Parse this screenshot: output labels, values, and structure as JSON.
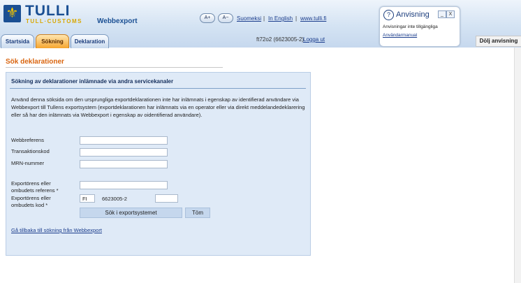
{
  "header": {
    "logo_main": "TULLI",
    "logo_sub": "TULL·CUSTOMS",
    "app_name": "Webbexport",
    "font_increase": "A+",
    "font_decrease": "A−",
    "lang_finnish": "Suomeksi",
    "lang_english": "In English",
    "site_link": "www.tulli.fi",
    "separator": "|",
    "user_info": "ft72o2 (6623005-2)",
    "logout": "Logga ut"
  },
  "tabs": [
    {
      "label": "Startsida",
      "active": false
    },
    {
      "label": "Sökning",
      "active": true
    },
    {
      "label": "Deklaration",
      "active": false
    }
  ],
  "help": {
    "icon": "?",
    "title": "Anvisning",
    "minimize": "_",
    "close": "X",
    "text": "Anvisningar inte tillgängliga",
    "manual_link": "Användarmanual",
    "hide_button": "Dölj anvisning"
  },
  "page": {
    "title": "Sök deklarationer",
    "panel_title": "Sökning av deklarationer inlämnade via andra servicekanaler",
    "description": "Använd denna söksida om den ursprungliga exportdeklarationen inte har inlämnats i egenskap av identifierad användare via Webbexport till Tullens exportsystem (exportdeklarationen har inlämnats via en operator eller via direkt meddelandedeklarering eller så har den inlämnats via Webbexport i egenskap av oidentifierad användare).",
    "fields": {
      "webbreferens_label": "Webbreferens",
      "transaktionskod_label": "Transaktionskod",
      "mrn_label": "MRN-nummer",
      "ref_label_line1": "Exportörens eller",
      "ref_label_line2": "ombudets referens  *",
      "code_label_line1": "Exportörens eller",
      "code_label_line2": "ombudets kod  *",
      "country_code": "FI",
      "company_code": "6623005-2",
      "webbreferens_value": "",
      "transaktionskod_value": "",
      "mrn_value": "",
      "ref_value": "",
      "code_suffix_value": ""
    },
    "search_button": "Sök i exportsystemet",
    "clear_button": "Töm",
    "back_link": "Gå tillbaka till sökning från Webbexport"
  }
}
